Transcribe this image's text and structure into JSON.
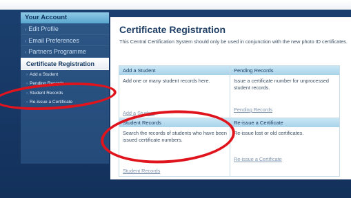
{
  "sidebar": {
    "header": "Your Account",
    "items": [
      {
        "label": "Edit Profile"
      },
      {
        "label": "Email Preferences"
      },
      {
        "label": "Partners Programme"
      }
    ],
    "active": "Certificate Registration",
    "sub_items": [
      {
        "label": "Add a Student"
      },
      {
        "label": "Pending Records"
      },
      {
        "label": "Student Records"
      },
      {
        "label": "Re-issue a Certificate"
      }
    ]
  },
  "main": {
    "title": "Certificate Registration",
    "intro": "This Central Certification System should only be used in conjunction with the new photo ID certificates.",
    "cards": [
      {
        "heading": "Add a Student",
        "text": "Add one or many student records here.",
        "link": "Add a Student"
      },
      {
        "heading": "Pending Records",
        "text": "Issue a certificate number for unprocessed student records.",
        "link": "Pending Records"
      },
      {
        "heading": "Student Records",
        "text": "Search the records of students who have been issued certificate numbers.",
        "link": "Student Records"
      },
      {
        "heading": "Re-issue a Certificate",
        "text": "Re-issue lost or old certificates.",
        "link": "Re-issue a Certificate"
      }
    ]
  },
  "colors": {
    "annotation": "#e0141d",
    "page_background": "#1b3a66",
    "accent_header": "#a8d3ea"
  }
}
